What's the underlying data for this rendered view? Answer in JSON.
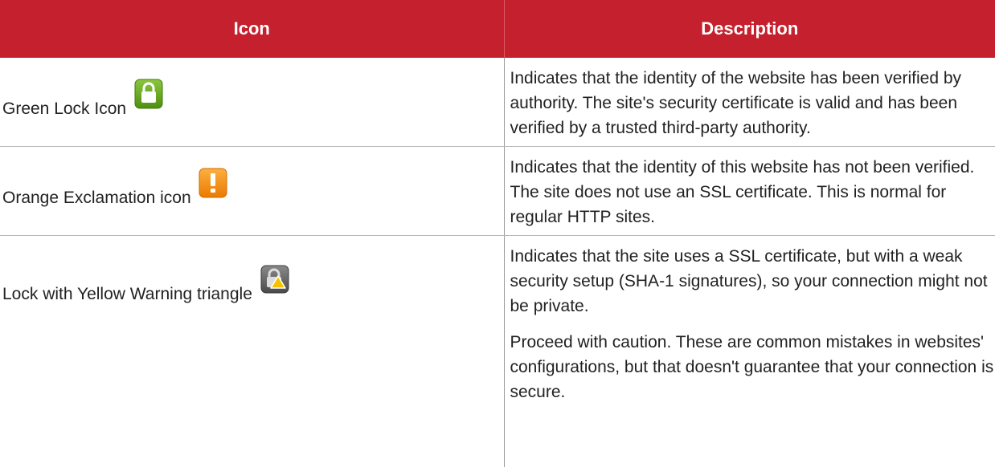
{
  "table": {
    "headers": [
      "Icon",
      "Description"
    ],
    "rows": [
      {
        "icon_label": "Green Lock Icon",
        "icon_name": "green-lock-icon",
        "description": [
          "Indicates that the identity of the website has been verified by authority. The site's security certificate is valid and has been verified by a trusted third-party authority."
        ]
      },
      {
        "icon_label": "Orange Exclamation icon",
        "icon_name": "orange-exclamation-icon",
        "description": [
          "Indicates that the identity of this website has not been verified. The site does not use an SSL certificate. This is normal for regular HTTP sites."
        ]
      },
      {
        "icon_label": "Lock with Yellow Warning triangle",
        "icon_name": "lock-warning-triangle-icon",
        "description": [
          "Indicates that the site uses a SSL certificate, but with a weak security setup (SHA-1 signatures), so your connection might not be private.",
          "Proceed with caution. These are common mistakes in websites' configurations, but that doesn't guarantee that your connection is secure."
        ]
      }
    ]
  },
  "colors": {
    "header_bg": "#c5202d",
    "header_text": "#ffffff",
    "green_icon": "#6aa61e",
    "orange_icon": "#f08a0c",
    "gray_icon": "#5e5e5e",
    "warning_yellow": "#f6c200"
  }
}
